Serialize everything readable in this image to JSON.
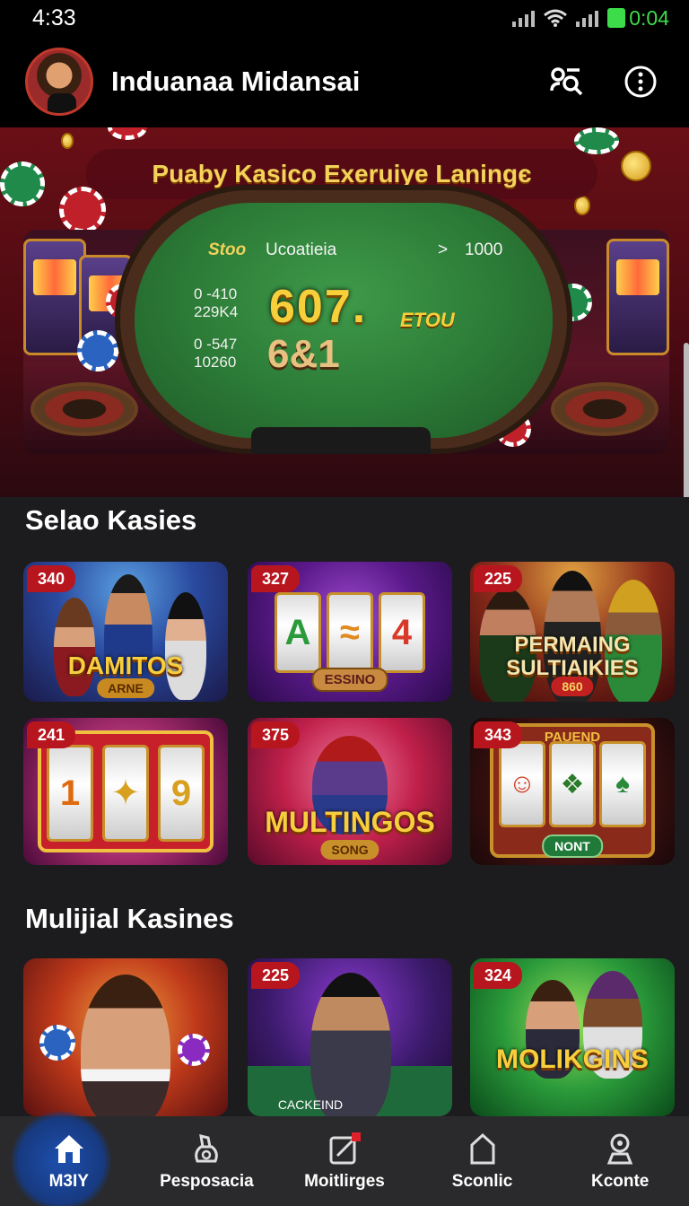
{
  "status_bar": {
    "time": "4:33",
    "battery_text": "0:04",
    "battery_color": "#3ddc4a"
  },
  "header": {
    "title": "Induanaa Midansai",
    "search_icon": "search-user-icon",
    "menu_icon": "more-vertical-icon"
  },
  "hero": {
    "title": "Puaby Kasico Exeruiye Laningє",
    "table": {
      "label": "Stoo",
      "name": "Ucoatieia",
      "chevron": ">",
      "amount": "1000",
      "left_top_1": "0 -410",
      "left_top_2": "229K4",
      "left_bottom_1": "0 -547",
      "left_bottom_2": "10260",
      "big_number": "607.",
      "big_tag": "ETOU",
      "second_number": "6&1"
    }
  },
  "sections": [
    {
      "title": "Selao Kasies",
      "cards": [
        {
          "badge": "340",
          "logo": "DAMITOS",
          "sub": "ARNE"
        },
        {
          "badge": "327",
          "logo": "",
          "sub": "ESSINO"
        },
        {
          "badge": "225",
          "logo": "PERMAING SULTIAIKIES",
          "sub": "860"
        },
        {
          "badge": "241",
          "logo": "",
          "sub": ""
        },
        {
          "badge": "375",
          "logo": "MULTINGOS",
          "sub": "SONG"
        },
        {
          "badge": "343",
          "logo": "",
          "sub": "NONT",
          "top_label": "PAUEND"
        }
      ]
    },
    {
      "title": "Mulijial Kasines",
      "cards": [
        {
          "badge": "",
          "logo": "",
          "sub": ""
        },
        {
          "badge": "225",
          "logo": "",
          "sub": "CACKEIND"
        },
        {
          "badge": "324",
          "logo": "MOLIKGINS",
          "sub": ""
        }
      ]
    }
  ],
  "bottom_nav": {
    "active_color": "#1e4fae",
    "items": [
      {
        "label": "M3IY",
        "icon": "home-icon"
      },
      {
        "label": "Pesposacia",
        "icon": "bag-icon"
      },
      {
        "label": "Moitlirges",
        "icon": "edit-icon"
      },
      {
        "label": "Sconlic",
        "icon": "house-outline-icon"
      },
      {
        "label": "Kconte",
        "icon": "profile-icon"
      }
    ]
  }
}
